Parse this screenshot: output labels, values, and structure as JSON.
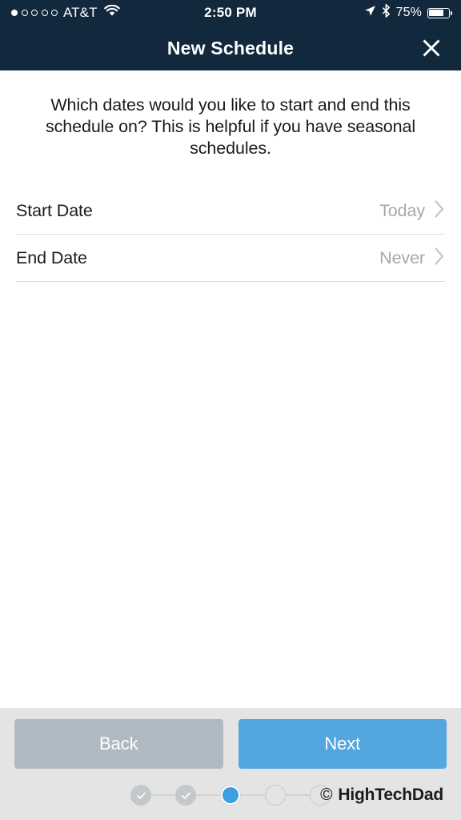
{
  "status_bar": {
    "carrier": "AT&T",
    "signal_dots_total": 5,
    "signal_dots_filled": 1,
    "wifi_icon": "wifi-icon",
    "time": "2:50 PM",
    "location_icon": "location-arrow-icon",
    "bluetooth_icon": "bluetooth-icon",
    "battery_percent": "75%",
    "battery_level": 75
  },
  "nav": {
    "title": "New Schedule",
    "close_icon": "close-icon"
  },
  "main": {
    "prompt": "Which dates would you like to start and end this schedule on? This is helpful if you have seasonal schedules.",
    "rows": [
      {
        "label": "Start Date",
        "value": "Today",
        "chevron": "chevron-right-icon"
      },
      {
        "label": "End Date",
        "value": "Never",
        "chevron": "chevron-right-icon"
      }
    ]
  },
  "footer": {
    "back_label": "Back",
    "next_label": "Next",
    "steps": [
      {
        "state": "done"
      },
      {
        "state": "done"
      },
      {
        "state": "active"
      },
      {
        "state": "todo"
      },
      {
        "state": "todo"
      }
    ],
    "watermark_symbol": "©",
    "watermark_text": "HighTechDad"
  },
  "colors": {
    "navbar_bg": "#12293d",
    "accent_blue": "#54a6e0",
    "active_step_blue": "#3d9ee0",
    "back_button_gray": "#afbac3",
    "footer_bg": "#e4e4e4",
    "value_text_gray": "#a8a8a8"
  }
}
